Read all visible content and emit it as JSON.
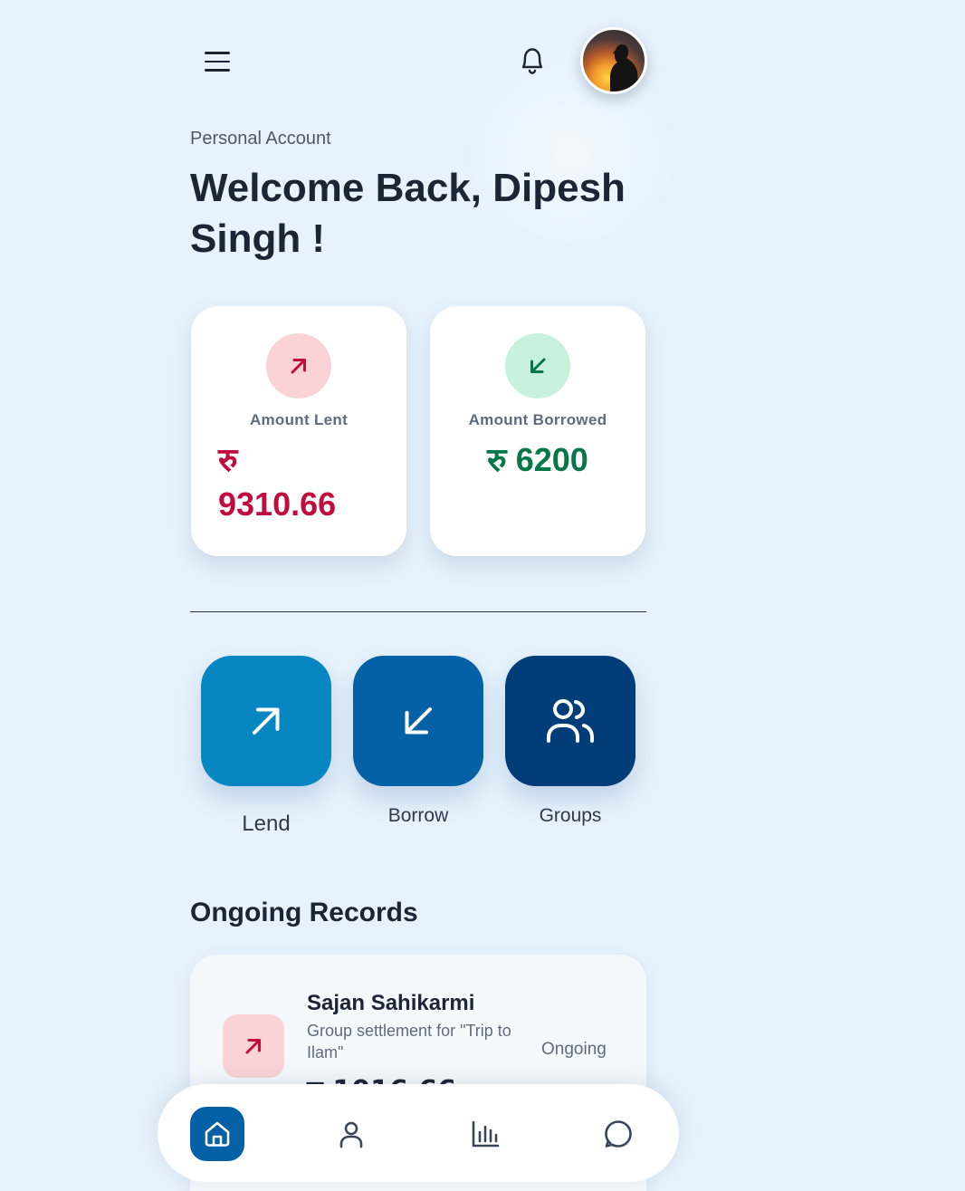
{
  "header": {
    "menu_icon": "hamburger-icon",
    "notification_icon": "bell-icon",
    "avatar_alt": "profile-avatar"
  },
  "greeting": {
    "subtitle": "Personal Account",
    "title": "Welcome Back, Dipesh Singh !"
  },
  "summary": {
    "lent": {
      "label": "Amount Lent",
      "currency": "रु",
      "amount": "9310.66",
      "icon": "arrow-up-right-icon",
      "color": "#c00d3d"
    },
    "borrowed": {
      "label": "Amount Borrowed",
      "currency": "रु",
      "amount": "6200",
      "icon": "arrow-down-left-icon",
      "color": "#087747"
    }
  },
  "actions": [
    {
      "label": "Lend",
      "icon": "arrow-up-right-icon",
      "color": "#0786c2"
    },
    {
      "label": "Borrow",
      "icon": "arrow-down-left-icon",
      "color": "#0461a6"
    },
    {
      "label": "Groups",
      "icon": "users-icon",
      "color": "#013d79"
    }
  ],
  "records": {
    "title": "Ongoing Records",
    "items": [
      {
        "name": "Sajan Sahikarmi",
        "description": "Group settlement for \"Trip to Ilam\"",
        "status": "Ongoing",
        "amount": "रु 1016.66",
        "icon": "arrow-up-right-icon"
      }
    ]
  },
  "bottom_nav": [
    {
      "name": "home",
      "icon": "home-icon",
      "active": true
    },
    {
      "name": "profile",
      "icon": "user-icon",
      "active": false
    },
    {
      "name": "stats",
      "icon": "bar-chart-icon",
      "active": false
    },
    {
      "name": "chat",
      "icon": "chat-icon",
      "active": false
    }
  ],
  "colors": {
    "background": "#e6f2fc",
    "primary": "#0461a6",
    "text": "#1b2536"
  }
}
